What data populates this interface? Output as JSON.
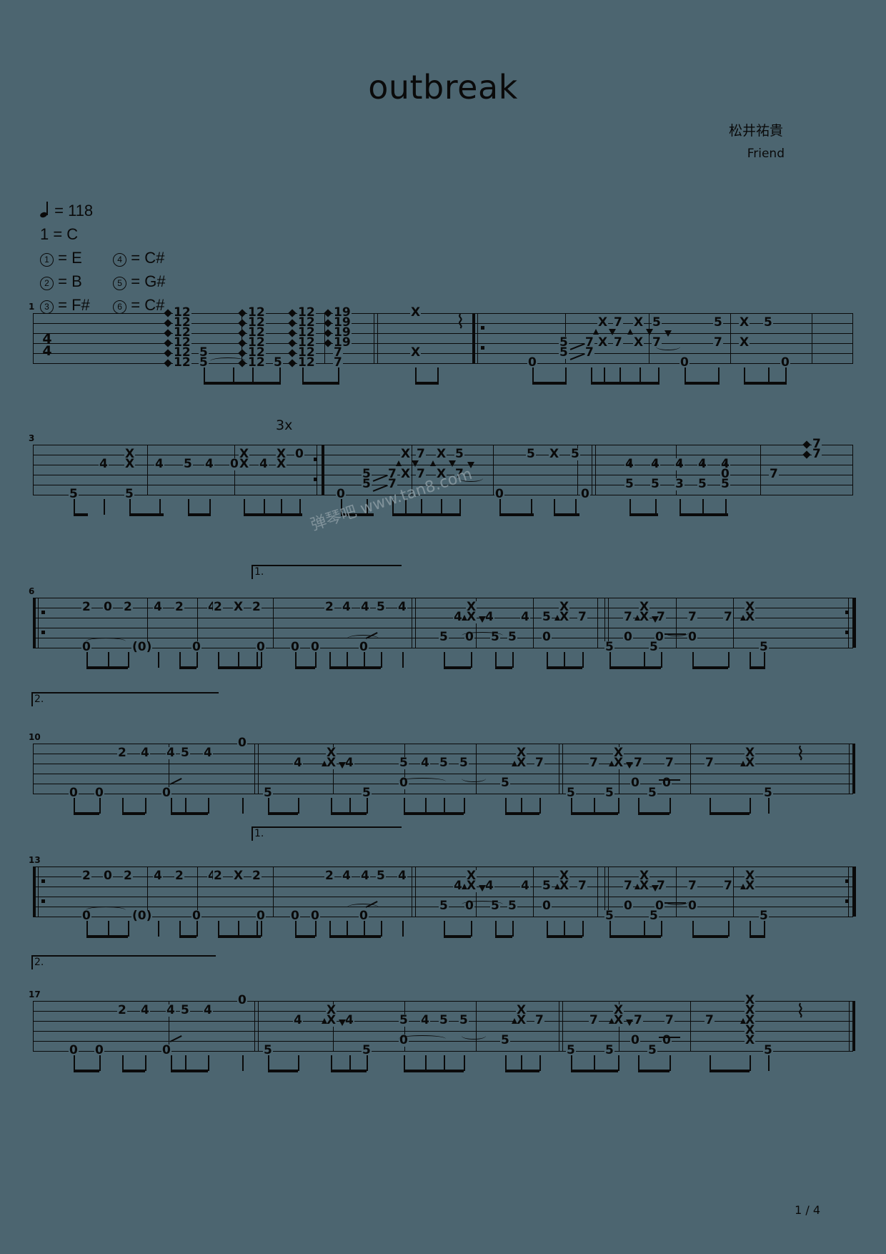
{
  "document": {
    "title": "outbreak",
    "composer": "松井祐貴",
    "album": "Friend",
    "page_label": "1 / 4",
    "watermark": "弹琴吧 www.tan8.com",
    "background_color": "#4c6570",
    "ink_color": "#0a0a0a"
  },
  "performance_info": {
    "tempo_label": "= 118",
    "tempo_bpm": "118",
    "key_label": "1 = C",
    "time_signature": {
      "numerator": "4",
      "denominator": "4"
    },
    "tuning": [
      {
        "string": "1",
        "note": "= E"
      },
      {
        "string": "4",
        "note": "= C#"
      },
      {
        "string": "2",
        "note": "= B"
      },
      {
        "string": "5",
        "note": "= G#"
      },
      {
        "string": "3",
        "note": "= F#"
      },
      {
        "string": "6",
        "note": "= C#"
      }
    ]
  },
  "markings": {
    "repeat_3x": "3x",
    "volta_1": "1.",
    "volta_2": "2."
  },
  "systems": [
    {
      "measure_number": "1",
      "notes": [
        "12",
        "12",
        "12",
        "12",
        "12",
        "5",
        "5",
        "12",
        "12",
        "12",
        "12",
        "12",
        "5",
        "12",
        "12",
        "12",
        "12",
        "12",
        "7",
        "19",
        "19",
        "19",
        "7",
        "7",
        "X",
        "X",
        "0",
        "5",
        "5",
        "7",
        "7",
        "X",
        "X",
        "7",
        "7",
        "7",
        "X",
        "X",
        "7",
        "5",
        "7",
        "0",
        "5",
        "X",
        "5",
        "7",
        "X",
        "0"
      ]
    },
    {
      "measure_number": "3",
      "notes": [
        "5",
        "4",
        "X",
        "X",
        "0",
        "4",
        "5",
        "5",
        "4",
        "4",
        "0",
        "X",
        "X",
        "4",
        "X",
        "X",
        "0",
        "0",
        "5",
        "7",
        "5",
        "7",
        "X",
        "7",
        "X",
        "7",
        "7",
        "X",
        "5",
        "0",
        "5",
        "X",
        "5",
        "0",
        "0",
        "4",
        "4",
        "4",
        "4",
        "4",
        "4",
        "4",
        "5",
        "5",
        "5",
        "3",
        "5",
        "0",
        "5",
        "5",
        "5",
        "7",
        "7",
        "7"
      ]
    },
    {
      "measure_number": "6",
      "notes": [
        "2",
        "0",
        "2",
        "4",
        "0",
        "(0)",
        "2",
        "2",
        "X",
        "2",
        "0",
        "2",
        "4",
        "5",
        "4",
        "0",
        "0",
        "0",
        "0",
        "0",
        "0",
        "4",
        "X",
        "X",
        "4",
        "4",
        "5",
        "X",
        "X",
        "7",
        "5",
        "5",
        "5",
        "0",
        "0",
        "0",
        "7",
        "X",
        "X",
        "7",
        "7",
        "7",
        "X",
        "X",
        "0",
        "0",
        "5",
        "5",
        "5"
      ]
    },
    {
      "measure_number": "10",
      "notes": [
        "0",
        "0",
        "2",
        "4",
        "4",
        "5",
        "4",
        "0",
        "0",
        "5",
        "4",
        "X",
        "X",
        "4",
        "5",
        "4",
        "5",
        "5",
        "X",
        "X",
        "7",
        "5",
        "5",
        "5",
        "7",
        "X",
        "X",
        "7",
        "0",
        "7",
        "7",
        "X",
        "X",
        "0",
        "5",
        "5",
        "5"
      ]
    },
    {
      "measure_number": "13",
      "notes": [
        "2",
        "0",
        "2",
        "4",
        "0",
        "(0)",
        "2",
        "4",
        "2",
        "X",
        "2",
        "0",
        "2",
        "4",
        "4",
        "5",
        "4",
        "0",
        "0",
        "0",
        "0",
        "0",
        "4",
        "X",
        "X",
        "4",
        "4",
        "5",
        "X",
        "X",
        "7",
        "5",
        "5",
        "5",
        "0",
        "0",
        "7",
        "X",
        "X",
        "7",
        "7",
        "7",
        "X",
        "X",
        "0",
        "0",
        "5",
        "5",
        "5"
      ]
    },
    {
      "measure_number": "17",
      "notes": [
        "0",
        "0",
        "2",
        "4",
        "4",
        "5",
        "4",
        "0",
        "0",
        "5",
        "4",
        "X",
        "X",
        "4",
        "5",
        "4",
        "5",
        "5",
        "X",
        "X",
        "7",
        "5",
        "5",
        "5",
        "7",
        "X",
        "X",
        "7",
        "0",
        "7",
        "7",
        "X",
        "X",
        "X",
        "X",
        "5",
        "5",
        "5"
      ]
    }
  ]
}
